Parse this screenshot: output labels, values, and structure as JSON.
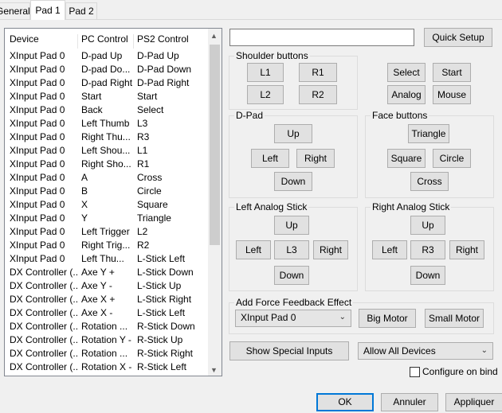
{
  "tabs": [
    "General",
    "Pad 1",
    "Pad 2"
  ],
  "list": {
    "headers": [
      "Device",
      "PC Control",
      "PS2 Control"
    ],
    "rows": [
      [
        "XInput Pad 0",
        "D-pad Up",
        "D-Pad Up"
      ],
      [
        "XInput Pad 0",
        "D-pad Do...",
        "D-Pad Down"
      ],
      [
        "XInput Pad 0",
        "D-pad Right",
        "D-Pad Right"
      ],
      [
        "XInput Pad 0",
        "Start",
        "Start"
      ],
      [
        "XInput Pad 0",
        "Back",
        "Select"
      ],
      [
        "XInput Pad 0",
        "Left Thumb",
        "L3"
      ],
      [
        "XInput Pad 0",
        "Right Thu...",
        "R3"
      ],
      [
        "XInput Pad 0",
        "Left Shou...",
        "L1"
      ],
      [
        "XInput Pad 0",
        "Right Sho...",
        "R1"
      ],
      [
        "XInput Pad 0",
        "A",
        "Cross"
      ],
      [
        "XInput Pad 0",
        "B",
        "Circle"
      ],
      [
        "XInput Pad 0",
        "X",
        "Square"
      ],
      [
        "XInput Pad 0",
        "Y",
        "Triangle"
      ],
      [
        "XInput Pad 0",
        "Left Trigger",
        "L2"
      ],
      [
        "XInput Pad 0",
        "Right Trig...",
        "R2"
      ],
      [
        "XInput Pad 0",
        "Left Thu...",
        "L-Stick Left"
      ],
      [
        "DX Controller (...",
        "Axe Y +",
        "L-Stick Down"
      ],
      [
        "DX Controller (...",
        "Axe Y -",
        "L-Stick Up"
      ],
      [
        "DX Controller (...",
        "Axe X +",
        "L-Stick Right"
      ],
      [
        "DX Controller (...",
        "Axe X -",
        "L-Stick Left"
      ],
      [
        "DX Controller (...",
        "Rotation ...",
        "R-Stick Down"
      ],
      [
        "DX Controller (...",
        "Rotation Y -",
        "R-Stick Up"
      ],
      [
        "DX Controller (...",
        "Rotation ...",
        "R-Stick Right"
      ],
      [
        "DX Controller (...",
        "Rotation X -",
        "R-Stick Left"
      ]
    ]
  },
  "quick_setup": "Quick Setup",
  "shoulder": {
    "title": "Shoulder buttons",
    "l1": "L1",
    "r1": "R1",
    "l2": "L2",
    "r2": "R2"
  },
  "misc": {
    "select": "Select",
    "start": "Start",
    "analog": "Analog",
    "mouse": "Mouse"
  },
  "dpad": {
    "title": "D-Pad",
    "up": "Up",
    "left": "Left",
    "right": "Right",
    "down": "Down"
  },
  "face": {
    "title": "Face buttons",
    "triangle": "Triangle",
    "square": "Square",
    "circle": "Circle",
    "cross": "Cross"
  },
  "lstick": {
    "title": "Left Analog Stick",
    "up": "Up",
    "left": "Left",
    "center": "L3",
    "right": "Right",
    "down": "Down"
  },
  "rstick": {
    "title": "Right Analog Stick",
    "up": "Up",
    "left": "Left",
    "center": "R3",
    "right": "Right",
    "down": "Down"
  },
  "ff": {
    "title": "Add Force Feedback Effect",
    "device": "XInput Pad 0",
    "big": "Big Motor",
    "small": "Small Motor"
  },
  "special": "Show Special Inputs",
  "devices_filter": "Allow All Devices",
  "configure_on_bind": "Configure on bind",
  "footer": {
    "ok": "OK",
    "cancel": "Annuler",
    "apply": "Appliquer"
  }
}
